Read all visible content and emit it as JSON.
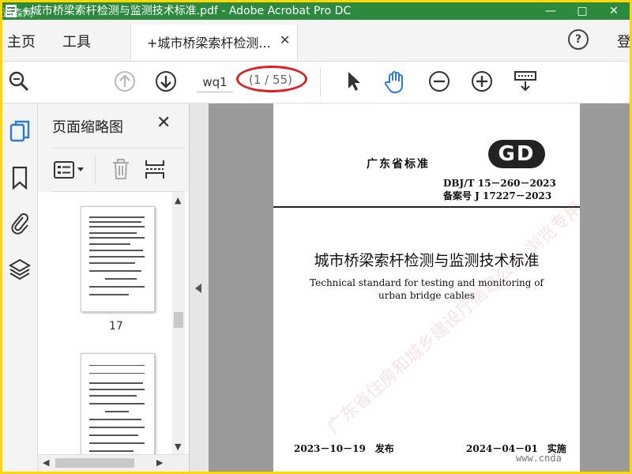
{
  "window": {
    "title": "+城市桥梁索杆检测与监测技术标准.pdf - Adobe Acrobat Pro DC",
    "controls": [
      "—",
      "□",
      "✕"
    ],
    "corner_watermark": "道森网"
  },
  "tabs": {
    "home": "主页",
    "tools": "工具",
    "document": "+城市桥梁索杆检测...",
    "close": "✕",
    "help": "?",
    "login": "登"
  },
  "toolbar": {
    "page_input": "wq1",
    "page_count": "(1 / 55)"
  },
  "sidebar_panel": {
    "title": "页面缩略图",
    "close": "✕",
    "thumbnails": [
      {
        "page_label": "17"
      },
      {
        "page_label": ""
      }
    ]
  },
  "document": {
    "standard_type": "广东省标准",
    "logo_text": "GD",
    "code": "DBJ/T 15－260－2023",
    "record": "备案号 J 17227－2023",
    "title_cn": "城市桥梁索杆检测与监测技术标准",
    "title_en_line1": "Technical standard for testing and monitoring of",
    "title_en_line2": "urban bridge cables",
    "watermark": "广东省住房和城乡建设厅信息公开 浏览专用",
    "published": "2023－10－19　发布",
    "implemented": "2024－04－01　实施"
  },
  "overlay": {
    "site_watermark": "www.cnda"
  },
  "colors": {
    "title_bar": "#2b8a3e",
    "border": "#ffd700",
    "annotation": "#e02020",
    "active_icon": "#2a7ad6"
  }
}
